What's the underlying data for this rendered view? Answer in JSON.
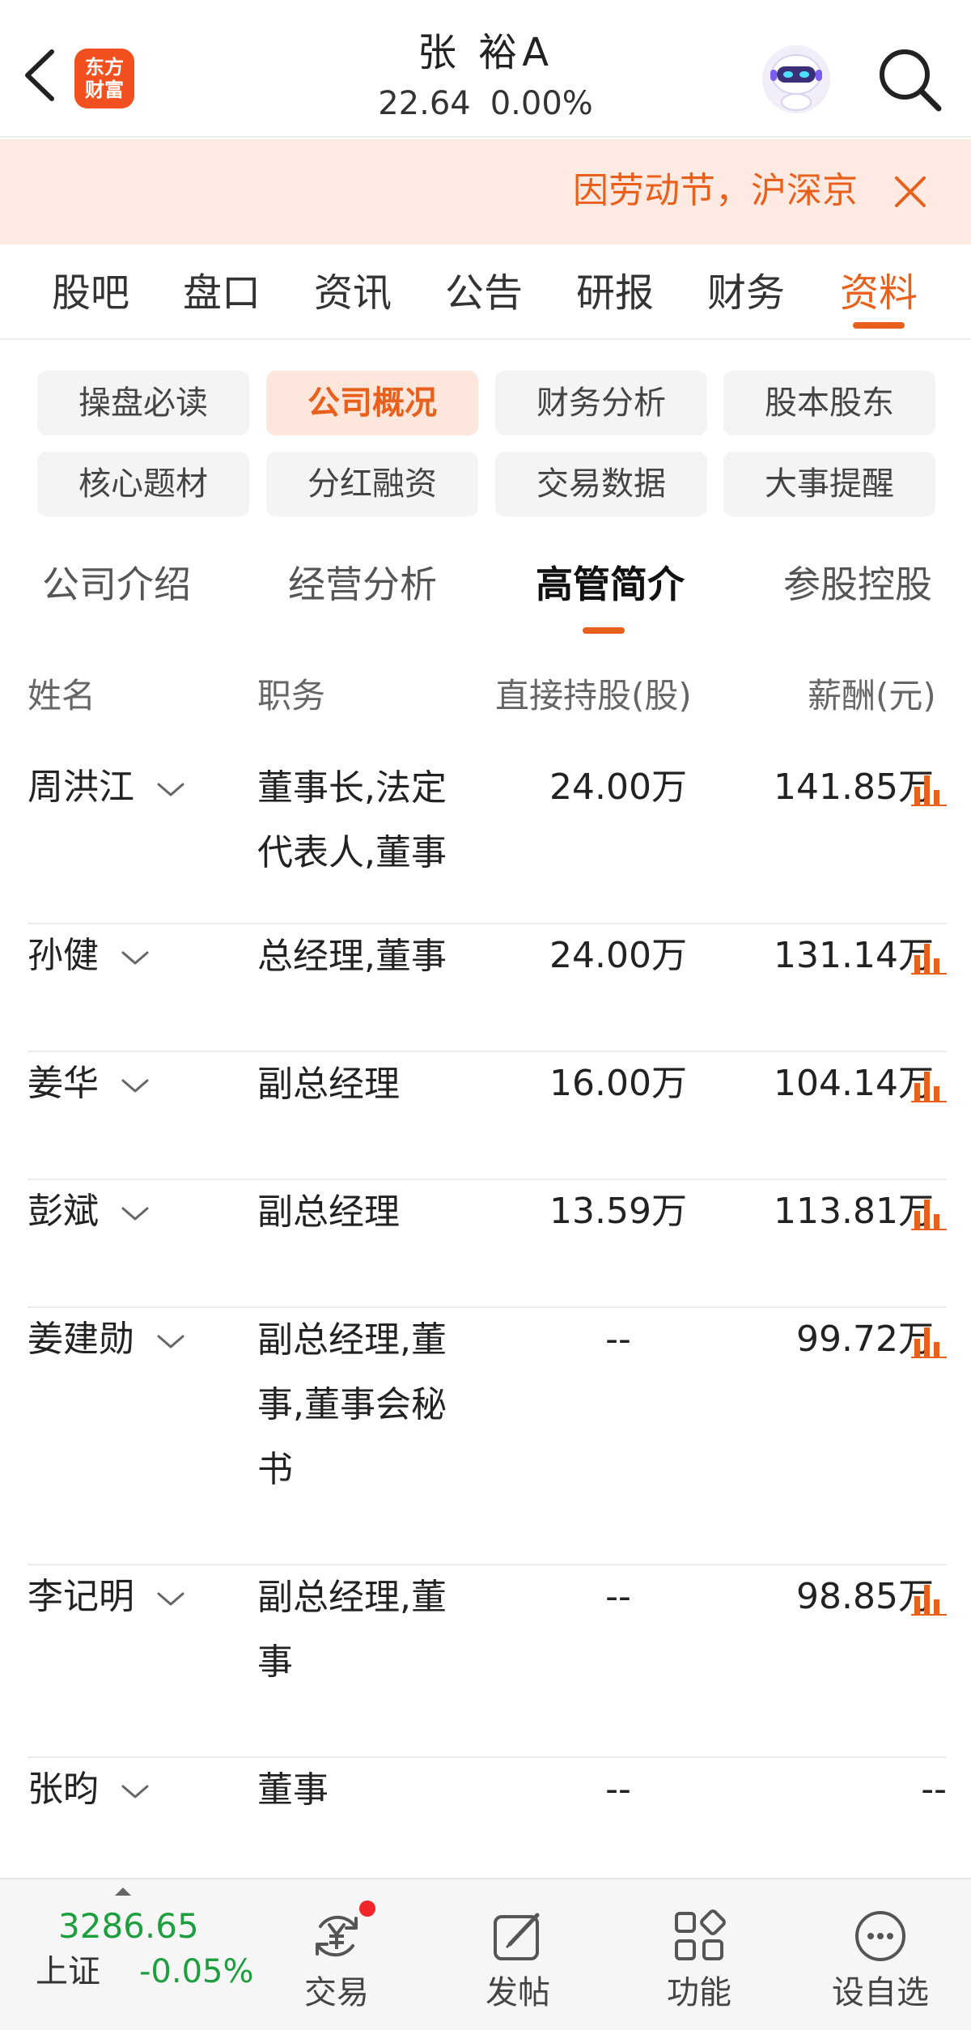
{
  "header": {
    "stock_name": "张 裕A",
    "price": "22.64",
    "change_pct": "0.00%",
    "logo_line1": "东方",
    "logo_line2": "财富"
  },
  "notice": {
    "text": "因劳动节，沪深京"
  },
  "main_tabs": [
    {
      "label": "股吧"
    },
    {
      "label": "盘口"
    },
    {
      "label": "资讯"
    },
    {
      "label": "公告"
    },
    {
      "label": "研报"
    },
    {
      "label": "财务"
    },
    {
      "label": "资料",
      "active": true
    }
  ],
  "chips": [
    {
      "label": "操盘必读"
    },
    {
      "label": "公司概况",
      "active": true
    },
    {
      "label": "财务分析"
    },
    {
      "label": "股本股东"
    },
    {
      "label": "核心题材"
    },
    {
      "label": "分红融资"
    },
    {
      "label": "交易数据"
    },
    {
      "label": "大事提醒"
    }
  ],
  "sub_tabs": [
    {
      "label": "公司介绍"
    },
    {
      "label": "经营分析"
    },
    {
      "label": "高管简介",
      "active": true
    },
    {
      "label": "参股控股"
    }
  ],
  "table": {
    "headers": [
      "姓名",
      "职务",
      "直接持股(股)",
      "薪酬(元)"
    ],
    "rows": [
      {
        "name": "周洪江",
        "role_lines": [
          "董事长,法定",
          "代表人,董事"
        ],
        "shares": "24.00万",
        "pay": "141.85万",
        "has_chart": true
      },
      {
        "name": "孙健",
        "role_lines": [
          "总经理,董事"
        ],
        "shares": "24.00万",
        "pay": "131.14万",
        "has_chart": true
      },
      {
        "name": "姜华",
        "role_lines": [
          "副总经理"
        ],
        "shares": "16.00万",
        "pay": "104.14万",
        "has_chart": true
      },
      {
        "name": "彭斌",
        "role_lines": [
          "副总经理"
        ],
        "shares": "13.59万",
        "pay": "113.81万",
        "has_chart": true
      },
      {
        "name": "姜建勋",
        "role_lines": [
          "副总经理,董",
          "事,董事会秘",
          "书"
        ],
        "shares": "--",
        "pay": "99.72万",
        "has_chart": true
      },
      {
        "name": "李记明",
        "role_lines": [
          "副总经理,董",
          "事"
        ],
        "shares": "--",
        "pay": "98.85万",
        "has_chart": true
      },
      {
        "name": "张昀",
        "role_lines": [
          "董事"
        ],
        "shares": "--",
        "pay": "--",
        "has_chart": false
      }
    ]
  },
  "bottom_bar": {
    "index_value": "3286.65",
    "index_name": "上证",
    "index_change": "-0.05%",
    "nav": [
      {
        "label": "交易",
        "icon": "trade-yen-icon",
        "badge": true
      },
      {
        "label": "发帖",
        "icon": "edit-post-icon"
      },
      {
        "label": "功能",
        "icon": "apps-grid-icon"
      },
      {
        "label": "设自选",
        "icon": "more-dots-icon"
      }
    ]
  },
  "colors": {
    "accent": "#e8601c",
    "up_green": "#1e9e3e",
    "notice_bg": "#fdebe3"
  }
}
